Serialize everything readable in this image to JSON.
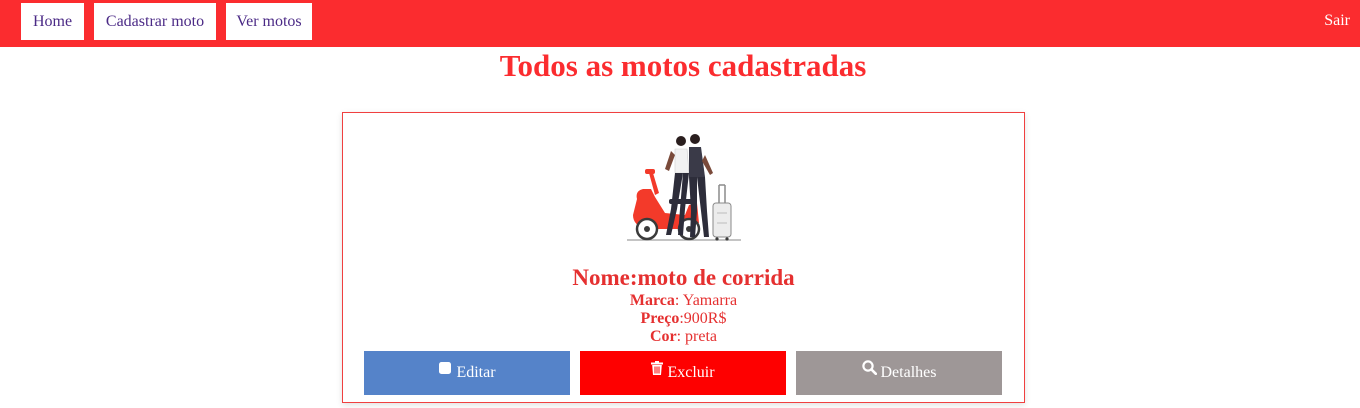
{
  "nav": {
    "home": "Home",
    "cadastrar": "Cadastrar moto",
    "ver": "Ver motos",
    "logout": "Sair"
  },
  "page": {
    "title": "Todos as motos cadastradas"
  },
  "card": {
    "name": "Nome:moto de corrida",
    "marca_label": "Marca",
    "marca_value": ": Yamarra",
    "preco_label": "Preço",
    "preco_value": ":900R$",
    "cor_label": "Cor",
    "cor_value": ": preta",
    "edit_label": "Editar",
    "delete_label": "Excluir",
    "details_label": "Detalhes"
  },
  "colors": {
    "brand_red": "#fb2c2f",
    "edit_blue": "#5583c9",
    "delete_red": "#fe0000",
    "details_gray": "#9e9797"
  },
  "icons": {
    "edit": "square-edit-icon",
    "delete": "trash-icon",
    "details": "search-icon"
  }
}
